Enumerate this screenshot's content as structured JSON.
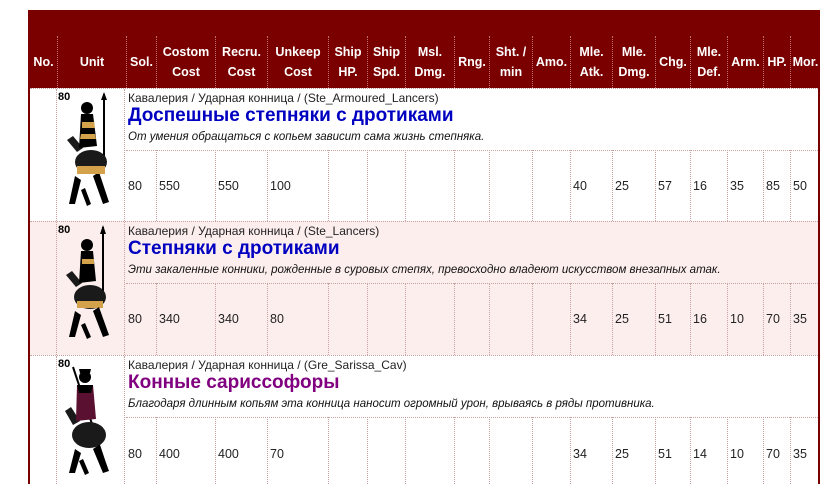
{
  "headers": [
    "No.",
    "Unit",
    "Sol.",
    "Costom Cost",
    "Recru. Cost",
    "Unkeep Cost",
    "Ship HP.",
    "Ship Spd.",
    "Msl. Dmg.",
    "Rng.",
    "Sht. / min",
    "Amo.",
    "Mle. Atk.",
    "Mle. Dmg.",
    "Chg.",
    "Mle. Def.",
    "Arm.",
    "HP.",
    "Mor."
  ],
  "colors": {
    "header_bg": "#7a0000",
    "alt_row_bg": "#fdeeee",
    "name_blue": "#0000c0",
    "name_purple": "#800080"
  },
  "units": [
    {
      "count": "80",
      "icon": "armoured-lancer-icon",
      "path": "Кавалерия / Ударная конница / (Ste_Armoured_Lancers)",
      "name": "Доспешные степняки с дротиками",
      "name_color": "#0000c0",
      "description": "От умения обращаться с копьем зависит сама жизнь степняка.",
      "stats": [
        "80",
        "550",
        "550",
        "100",
        "",
        "",
        "",
        "",
        "",
        "",
        "40",
        "25",
        "57",
        "16",
        "35",
        "85",
        "50"
      ]
    },
    {
      "count": "80",
      "icon": "lancer-icon",
      "path": "Кавалерия / Ударная конница / (Ste_Lancers)",
      "name": "Степняки с дротиками",
      "name_color": "#0000c0",
      "description": "Эти закаленные конники, рожденные в суровых степях, превосходно владеют искусством внезапных атак.",
      "stats": [
        "80",
        "340",
        "340",
        "80",
        "",
        "",
        "",
        "",
        "",
        "",
        "34",
        "25",
        "51",
        "16",
        "10",
        "70",
        "35"
      ]
    },
    {
      "count": "80",
      "icon": "sarissa-cavalry-icon",
      "path": "Кавалерия / Ударная конница / (Gre_Sarissa_Cav)",
      "name": "Конные сариссофоры",
      "name_color": "#800080",
      "description": "Благодаря длинным копьям эта конница наносит огромный урон, врываясь в ряды противника.",
      "stats": [
        "80",
        "400",
        "400",
        "70",
        "",
        "",
        "",
        "",
        "",
        "",
        "34",
        "25",
        "51",
        "14",
        "10",
        "70",
        "35"
      ]
    }
  ]
}
